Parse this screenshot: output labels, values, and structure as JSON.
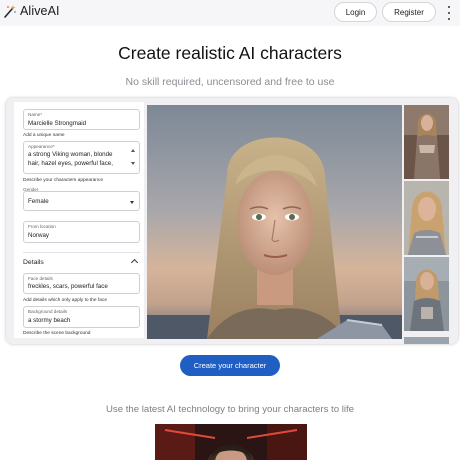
{
  "nav": {
    "logo_text": "AliveAI",
    "login_label": "Login",
    "register_label": "Register"
  },
  "hero": {
    "title": "Create realistic AI characters",
    "subtitle": "No skill required, uncensored and free to use"
  },
  "form": {
    "name": {
      "label": "Name*",
      "value": "Marcielle Strongmaid",
      "hint": "Add a unique name"
    },
    "appearance": {
      "label": "Appearance*",
      "value_lines": [
        "a strong Viking woman, blonde",
        "hair, hazel eyes, powerful face,"
      ],
      "hint": "Describe your characters appearance"
    },
    "gender": {
      "label": "Gender",
      "value": "Female"
    },
    "location": {
      "label": "From location",
      "value": "Norway"
    },
    "details": {
      "label": "Details"
    },
    "face_details": {
      "label": "Face details",
      "value": "freckles, scars, powerful face",
      "hint": "Add details which only apply to the face"
    },
    "background_details": {
      "label": "Background details",
      "value": "a stormy beach",
      "hint": "Describe the scene background"
    }
  },
  "cta": {
    "label": "Create your character"
  },
  "section": {
    "subtitle": "Use the latest AI technology to bring your characters to life"
  },
  "colors": {
    "accent": "#1f5fc4",
    "panel_bg": "#f0f0f2"
  }
}
